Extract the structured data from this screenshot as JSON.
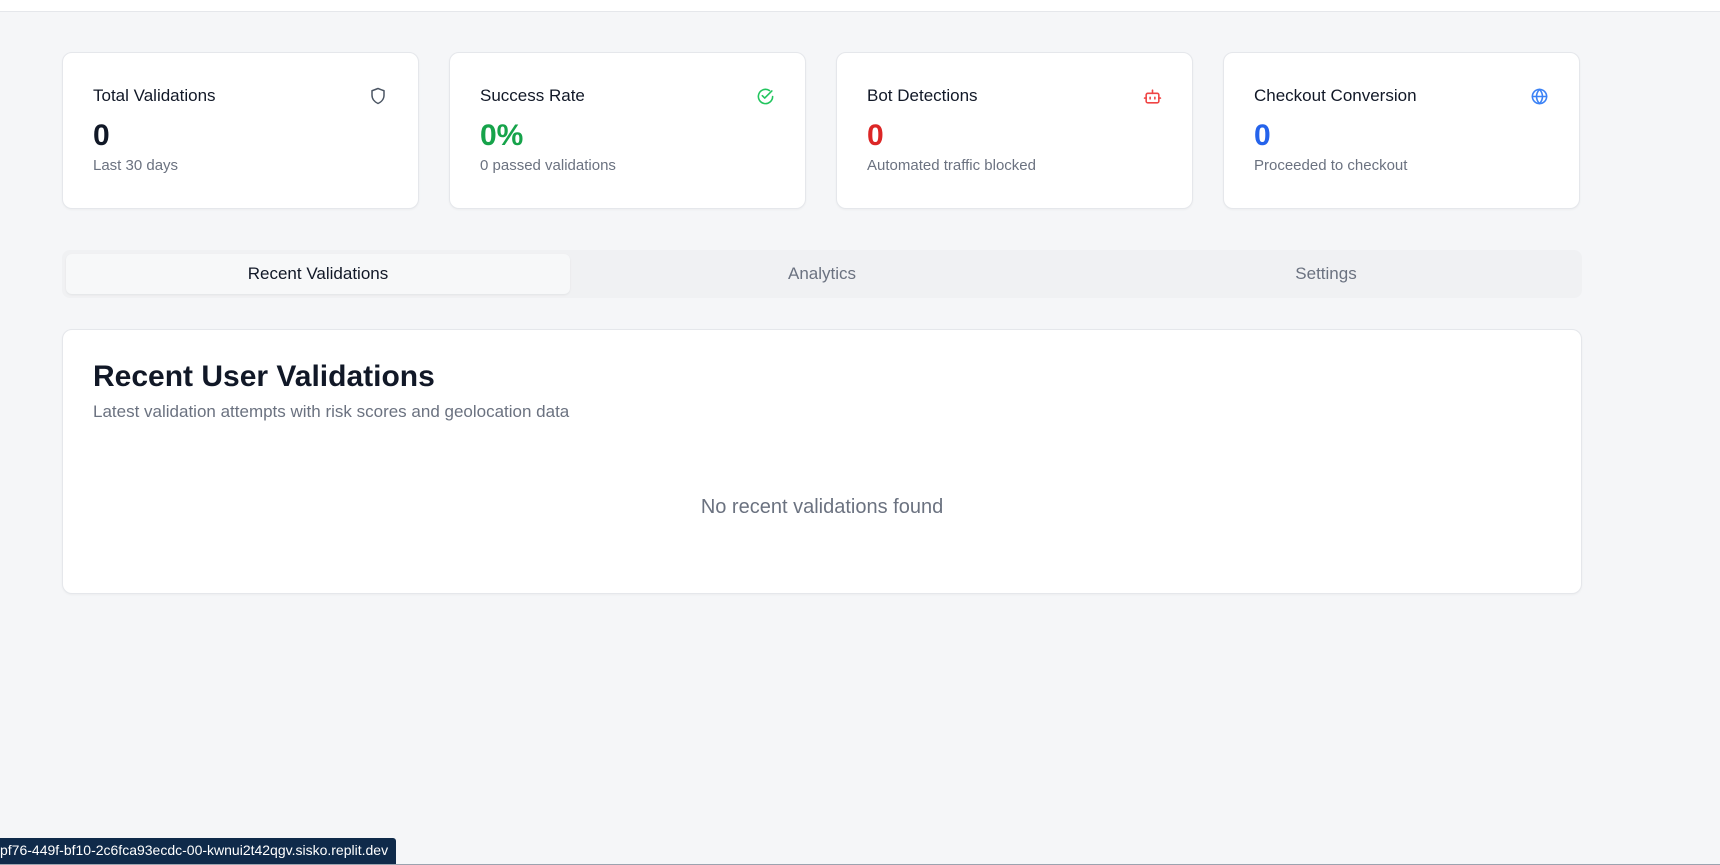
{
  "stats": [
    {
      "title": "Total Validations",
      "value": "0",
      "subtitle": "Last 30 days",
      "icon": "shield-icon",
      "color": "#111827",
      "icon_color": "#4b5563"
    },
    {
      "title": "Success Rate",
      "value": "0%",
      "subtitle": "0 passed validations",
      "icon": "check-circle-icon",
      "color": "#16a34a",
      "icon_color": "#22c55e"
    },
    {
      "title": "Bot Detections",
      "value": "0",
      "subtitle": "Automated traffic blocked",
      "icon": "bot-icon",
      "color": "#dc2626",
      "icon_color": "#ef4444"
    },
    {
      "title": "Checkout Conversion",
      "value": "0",
      "subtitle": "Proceeded to checkout",
      "icon": "globe-icon",
      "color": "#2563eb",
      "icon_color": "#3b82f6"
    }
  ],
  "tabs": [
    {
      "label": "Recent Validations",
      "active": true
    },
    {
      "label": "Analytics",
      "active": false
    },
    {
      "label": "Settings",
      "active": false
    }
  ],
  "panel": {
    "title": "Recent User Validations",
    "description": "Latest validation attempts with risk scores and geolocation data",
    "empty_message": "No recent validations found"
  },
  "status_url": "pf76-449f-bf10-2c6fca93ecdc-00-kwnui2t42qgv.sisko.replit.dev"
}
